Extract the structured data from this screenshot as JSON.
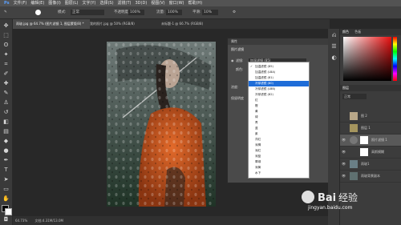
{
  "menu": [
    "文件(F)",
    "编辑(E)",
    "图像(I)",
    "图层(L)",
    "文字(Y)",
    "选择(S)",
    "滤镜(T)",
    "3D(D)",
    "视图(V)",
    "窗口(W)",
    "帮助(H)"
  ],
  "options": {
    "mode_label": "模式:",
    "mode_value": "正常",
    "opacity_label": "不透明度:",
    "opacity_value": "100%",
    "flow_label": "流量:",
    "flow_value": "100%",
    "smooth_label": "平滑:",
    "smooth_value": "10%"
  },
  "tabs": [
    "雨玻.jpg @ 64.7% (图片滤镜 1, 图层蒙版/8) *",
    "我的照片.jpg @ 50% (RGB/8)",
    "未标题-1 @ 66.7% (RGB/8)"
  ],
  "status": {
    "zoom": "64.73%",
    "doc": "文档:4.31M/13.0M"
  },
  "dialog": {
    "title": "属性",
    "subtitle": "照片滤镜",
    "filter_label": "滤镜:",
    "filter_value": "加温滤镜 (85)",
    "color_label": "颜色:",
    "density_label": "浓度:",
    "preserve_label": "保留明度"
  },
  "dropdown": {
    "items": [
      "加温滤镜 (85)",
      "加温滤镜 (LBA)",
      "加温滤镜 (81)",
      "冷却滤镜 (80)",
      "冷却滤镜 (LBB)",
      "冷却滤镜 (82)",
      "红",
      "橙",
      "黄",
      "绿",
      "青",
      "蓝",
      "紫",
      "洋红",
      "深褐",
      "深红",
      "深蓝",
      "翠绿",
      "深黄",
      "水下"
    ],
    "checked_index": 0,
    "selected_index": 3
  },
  "panel": {
    "tabs": [
      "颜色",
      "色板"
    ],
    "layers_title": "图层",
    "blend_mode": "正常",
    "layers": [
      {
        "name": "图 2",
        "visible": false
      },
      {
        "name": "图层 1",
        "visible": false
      },
      {
        "name": "照片滤镜 1",
        "visible": true
      },
      {
        "name": "高斯模糊",
        "visible": true
      },
      {
        "name": "雨玻1",
        "visible": true
      },
      {
        "name": "雨玻背景副本",
        "visible": true
      }
    ]
  },
  "watermark": {
    "site": "jingyan.baidu.com"
  }
}
